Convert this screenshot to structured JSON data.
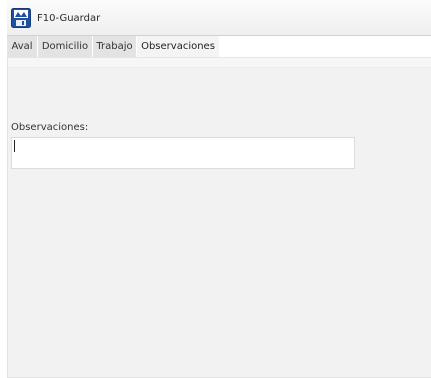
{
  "toolbar": {
    "save_label": "F10-Guardar",
    "save_icon": "save-disk-icon"
  },
  "tabs": [
    {
      "label": "Aval",
      "active": false
    },
    {
      "label": "Domicilio",
      "active": false
    },
    {
      "label": "Trabajo",
      "active": false
    },
    {
      "label": "Observaciones",
      "active": true
    }
  ],
  "form": {
    "observaciones_label": "Observaciones:",
    "observaciones_value": ""
  },
  "colors": {
    "icon_blue": "#1f4fa0",
    "panel_bg": "#f2f2f2",
    "tab_bg": "#e3e3e3"
  }
}
